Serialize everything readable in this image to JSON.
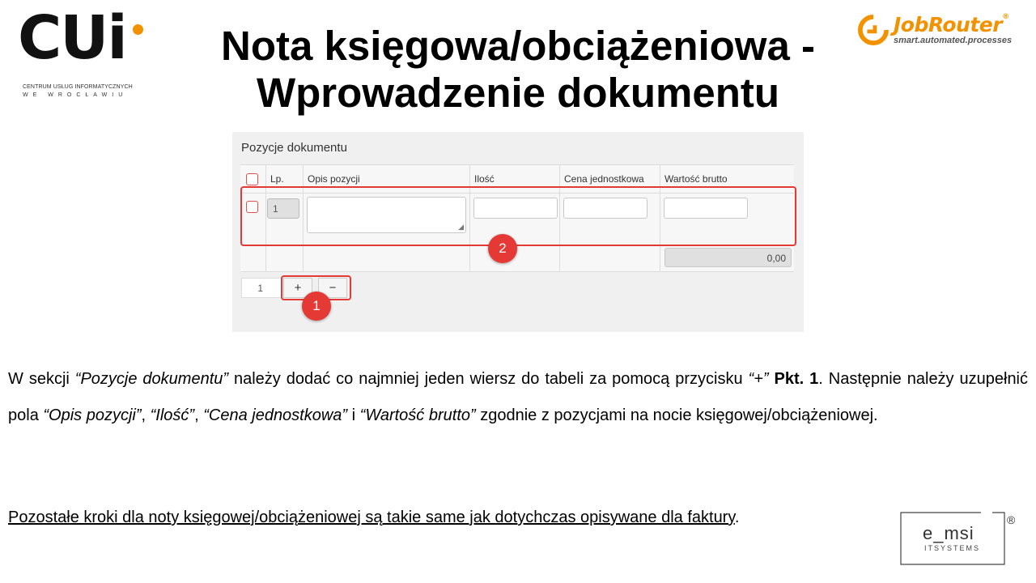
{
  "cui_logo": {
    "letters": "CUi",
    "line1": "CENTRUM USŁUG INFORMATYCZNYCH",
    "line2": "WE WROCŁAWIU"
  },
  "title_line1": "Nota księgowa/obciążeniowa -",
  "title_line2": "Wprowadzenie dokumentu",
  "jobrouter_logo": {
    "name": "JobRouter",
    "tagline": "smart.automated.processes",
    "color": "#f39200"
  },
  "screenshot": {
    "section_title": "Pozycje dokumentu",
    "columns": [
      "Lp.",
      "Opis pozycji",
      "Ilość",
      "Cena jednostkowa",
      "Wartość brutto"
    ],
    "row_lp": "1",
    "total_value": "0,00",
    "row_count": "1",
    "add_button": "+",
    "remove_button": "−",
    "badge1": "1",
    "badge2": "2",
    "highlight_color": "#e53935"
  },
  "paragraph": {
    "p1": "W sekcji ",
    "i1": "“Pozycje dokumentu”",
    "p2": " należy dodać co najmniej jeden wiersz do tabeli za pomocą przycisku ",
    "i2": "“+”",
    "p3": " ",
    "b1": "Pkt. 1",
    "p4": ". Następnie należy uzupełnić pola ",
    "i3": "“Opis pozycji”",
    "p5": ", ",
    "i4": "“Ilość”",
    "p6": ", ",
    "i5": "“Cena jednostkowa”",
    "p7": " i ",
    "i6": "“Wartość brutto”",
    "p8": " zgodnie z pozycjami na nocie księgowej/obciążeniowej."
  },
  "note": {
    "underlined": "Pozostałe kroki dla noty księgowej/obciążeniowej  są takie same jak dotychczas opisywane dla faktury",
    "end": "."
  },
  "emsi_logo": {
    "name": "e_msi",
    "sub": "ITSYSTEMS",
    "reg": "®"
  }
}
